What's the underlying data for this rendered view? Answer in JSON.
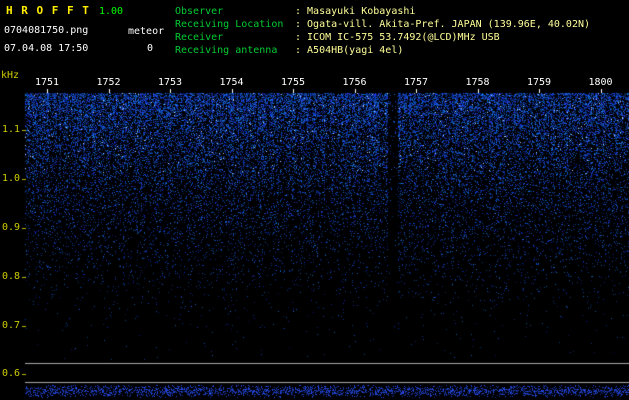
{
  "header": {
    "app_name": "H R O F F T",
    "version": "1.00",
    "filename": "0704081750.png",
    "mode_label": "meteor",
    "count": "0",
    "datetime": "07.04.08 17:50",
    "info": [
      {
        "label": "Observer",
        "value": ": Masayuki Kobayashi"
      },
      {
        "label": "Receiving Location",
        "value": ": Ogata-vill. Akita-Pref. JAPAN (139.96E, 40.02N)"
      },
      {
        "label": "Receiver",
        "value": ": ICOM IC-575 53.7492(@LCD)MHz USB"
      },
      {
        "label": "Receiving antenna",
        "value": ": A504HB(yagi 4el)"
      }
    ]
  },
  "chart_data": {
    "type": "heatmap",
    "title": "HROFFT meteor radio observation spectrogram 0704081750",
    "x_tick_labels": [
      "1751",
      "1752",
      "1753",
      "1754",
      "1755",
      "1756",
      "1757",
      "1758",
      "1759",
      "1800"
    ],
    "x_axis_meaning": "time (HHMM)",
    "y_axis_unit": "kHz",
    "y_tick_labels": [
      "1.1",
      "1.0",
      "0.9",
      "0.8",
      "0.7",
      "0.6"
    ],
    "y_range": [
      0.55,
      1.15
    ],
    "grid": "off",
    "legend": "off",
    "meteor_echo_count": 0,
    "content_description": "Broadband blue background noise, densest and brightest above ~1.0 kHz, fading toward black below ~0.75 kHz; quiet vertical gap near 1756.5; separate bottom strip bounded by two gray horizontal lines with a flat blue signal-level trace band along the bottom edge"
  },
  "colors": {
    "background": "#000000",
    "noise_blue": "#2a3cff",
    "title_yellow": "#ffee00",
    "version_green": "#00ff00",
    "info_label_green": "#00cc33",
    "info_value_yellow": "#ffff99",
    "axis_label_yellow": "#cccc00",
    "time_label_white": "#ffffff",
    "strip_line_gray": "#aaaaaa"
  }
}
